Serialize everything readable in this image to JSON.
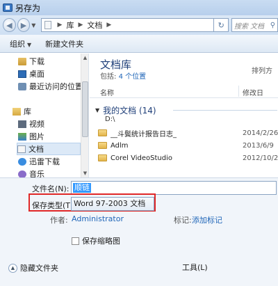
{
  "window": {
    "title": "另存为"
  },
  "address": {
    "path": [
      "库",
      "文档"
    ],
    "search_placeholder": "搜索 文档"
  },
  "toolbar": {
    "organize": "组织",
    "new_folder": "新建文件夹"
  },
  "sidebar": {
    "items": [
      {
        "label": "下载",
        "icon": "download-folder-icon"
      },
      {
        "label": "桌面",
        "icon": "desktop-icon"
      },
      {
        "label": "最近访问的位置",
        "icon": "recent-places-icon"
      },
      {
        "label": "库",
        "icon": "library-icon"
      },
      {
        "label": "视频",
        "icon": "video-icon"
      },
      {
        "label": "图片",
        "icon": "pictures-icon"
      },
      {
        "label": "文档",
        "icon": "documents-icon",
        "selected": true
      },
      {
        "label": "迅雷下载",
        "icon": "thunder-icon"
      },
      {
        "label": "音乐",
        "icon": "music-icon"
      }
    ]
  },
  "library": {
    "title": "文档库",
    "includes_prefix": "包括:",
    "includes_link": "4 个位置",
    "arrange": "排列方"
  },
  "columns": {
    "name": "名称",
    "date": "修改日"
  },
  "group": {
    "title": "我的文档 (14)",
    "path": "D:\\"
  },
  "files": [
    {
      "name": "__斗鬓统计报告日志_",
      "date": "2014/2/26"
    },
    {
      "name": "Adlm",
      "date": "2013/6/9"
    },
    {
      "name": "Corel VideoStudio",
      "date": "2012/10/2"
    }
  ],
  "form": {
    "filename_label": "文件名(N):",
    "filename_value": "顺链",
    "savetype_label": "保存类型(T):",
    "savetype_value": "Word 97-2003 文档",
    "author_label": "作者:",
    "author_value": "Administrator",
    "tags_label": "标记:",
    "tags_value": "添加标记",
    "thumbnail_label": "保存缩略图",
    "hide_folders": "隐藏文件夹",
    "tools": "工具(L)"
  },
  "colors": {
    "accent": "#1f3f79",
    "link": "#2066b8",
    "highlight": "#e02727"
  }
}
